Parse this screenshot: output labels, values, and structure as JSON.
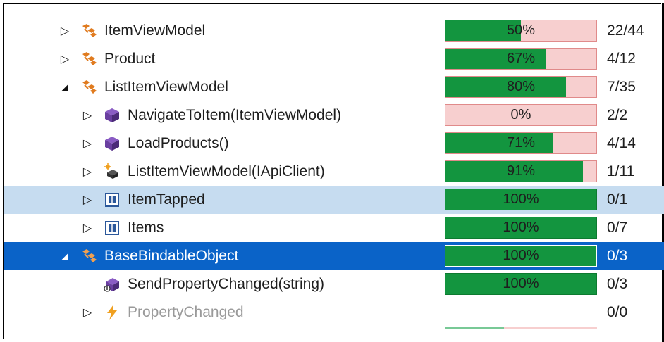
{
  "rows": [
    {
      "label": "ItemViewModel",
      "percent": "50%",
      "percent_value": 50,
      "count": "22/44",
      "icon": "class-icon",
      "toggle": "collapsed"
    },
    {
      "label": "Product",
      "percent": "67%",
      "percent_value": 67,
      "count": "4/12",
      "icon": "class-icon",
      "toggle": "collapsed"
    },
    {
      "label": "ListItemViewModel",
      "percent": "80%",
      "percent_value": 80,
      "count": "7/35",
      "icon": "class-icon",
      "toggle": "expanded"
    },
    {
      "label": "NavigateToItem(ItemViewModel)",
      "percent": "0%",
      "percent_value": 0,
      "count": "2/2",
      "icon": "method-icon",
      "toggle": "collapsed"
    },
    {
      "label": "LoadProducts()",
      "percent": "71%",
      "percent_value": 71,
      "count": "4/14",
      "icon": "method-icon",
      "toggle": "collapsed"
    },
    {
      "label": "ListItemViewModel(IApiClient)",
      "percent": "91%",
      "percent_value": 91,
      "count": "1/11",
      "icon": "constructor-icon",
      "toggle": "collapsed"
    },
    {
      "label": "ItemTapped",
      "percent": "100%",
      "percent_value": 100,
      "count": "0/1",
      "icon": "property-icon",
      "toggle": "collapsed"
    },
    {
      "label": "Items",
      "percent": "100%",
      "percent_value": 100,
      "count": "0/7",
      "icon": "property-icon",
      "toggle": "collapsed"
    },
    {
      "label": "BaseBindableObject",
      "percent": "100%",
      "percent_value": 100,
      "count": "0/3",
      "icon": "class-icon",
      "toggle": "expanded"
    },
    {
      "label": "SendPropertyChanged(string)",
      "percent": "100%",
      "percent_value": 100,
      "count": "0/3",
      "icon": "protected-method-icon",
      "toggle": "none"
    },
    {
      "label": "PropertyChanged",
      "percent": "",
      "percent_value": null,
      "count": "0/0",
      "icon": "event-icon",
      "toggle": "collapsed"
    }
  ],
  "colors": {
    "covered": "#13953f",
    "uncovered": "#f7cfcf",
    "hover_row": "#c6dcf0",
    "selected_row": "#0a63c8",
    "class_icon": "#e07b1f",
    "method_icon": "#6a3fa0",
    "property_icon": "#2b579a",
    "event_icon": "#f0a020"
  }
}
